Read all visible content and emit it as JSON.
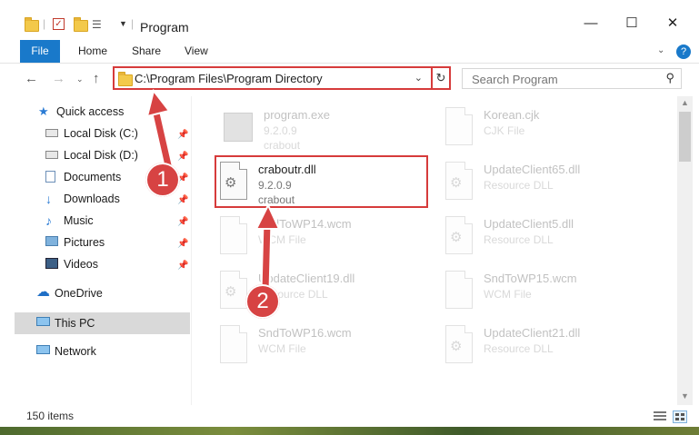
{
  "window": {
    "title": "Program"
  },
  "ribbon": {
    "file": "File",
    "tabs": [
      "Home",
      "Share",
      "View"
    ]
  },
  "address": {
    "path": "C:\\Program Files\\Program Directory"
  },
  "search": {
    "placeholder": "Search Program"
  },
  "sidebar": {
    "quick_access": "Quick access",
    "items": [
      {
        "label": "Local Disk (C:)",
        "icon": "drive-icon",
        "pinned": true
      },
      {
        "label": "Local Disk (D:)",
        "icon": "drive-icon",
        "pinned": true
      },
      {
        "label": "Documents",
        "icon": "documents-icon",
        "pinned": true
      },
      {
        "label": "Downloads",
        "icon": "download-arrow-icon",
        "pinned": true
      },
      {
        "label": "Music",
        "icon": "music-note-icon",
        "pinned": true
      },
      {
        "label": "Pictures",
        "icon": "pictures-icon",
        "pinned": true
      },
      {
        "label": "Videos",
        "icon": "film-icon",
        "pinned": true
      }
    ],
    "onedrive": "OneDrive",
    "this_pc": "This PC",
    "network": "Network"
  },
  "files": [
    {
      "name": "program.exe",
      "line1": "9.2.0.9",
      "line2": "crabout",
      "faded": true
    },
    {
      "name": "craboutr.dll",
      "line1": "9.2.0.9",
      "line2": "crabout",
      "faded": false,
      "highlighted": true
    },
    {
      "name": "SndToWP14.wcm",
      "line1": "WCM File",
      "line2": "",
      "faded": true
    },
    {
      "name": "UpdateClient19.dll",
      "line1": "Resource DLL",
      "line2": "",
      "faded": true
    },
    {
      "name": "SndToWP16.wcm",
      "line1": "WCM File",
      "line2": "",
      "faded": true
    },
    {
      "name": "Korean.cjk",
      "line1": "CJK File",
      "line2": "",
      "faded": true
    },
    {
      "name": "UpdateClient65.dll",
      "line1": "Resource DLL",
      "line2": "",
      "faded": true
    },
    {
      "name": "UpdateClient5.dll",
      "line1": "Resource DLL",
      "line2": "",
      "faded": true
    },
    {
      "name": "SndToWP15.wcm",
      "line1": "WCM File",
      "line2": "",
      "faded": true
    },
    {
      "name": "UpdateClient21.dll",
      "line1": "Resource DLL",
      "line2": "",
      "faded": true
    }
  ],
  "status": {
    "items": "150 items"
  },
  "annotations": {
    "step1": "1",
    "step2": "2"
  },
  "colors": {
    "accent": "#1979ca",
    "highlight": "#d63b3b"
  }
}
